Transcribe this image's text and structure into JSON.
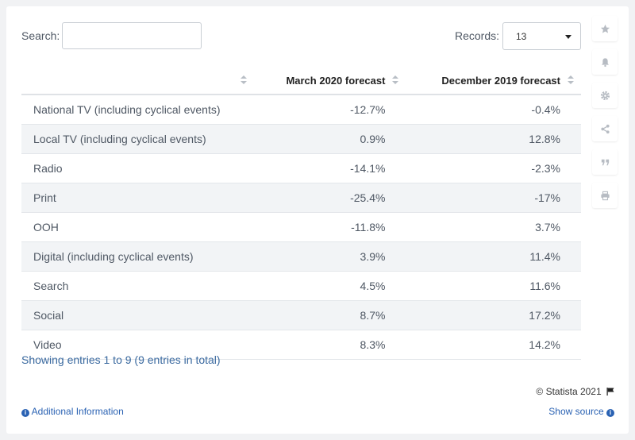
{
  "search": {
    "label": "Search:",
    "value": ""
  },
  "records": {
    "label": "Records:",
    "value": "13"
  },
  "table": {
    "headers": [
      "",
      "March 2020 forecast",
      "December 2019 forecast"
    ],
    "rows": [
      [
        "National TV (including cyclical events)",
        "-12.7%",
        "-0.4%"
      ],
      [
        "Local TV (including cyclical events)",
        "0.9%",
        "12.8%"
      ],
      [
        "Radio",
        "-14.1%",
        "-2.3%"
      ],
      [
        "Print",
        "-25.4%",
        "-17%"
      ],
      [
        "OOH",
        "-11.8%",
        "3.7%"
      ],
      [
        "Digital (including cyclical events)",
        "3.9%",
        "11.4%"
      ],
      [
        "Search",
        "4.5%",
        "11.6%"
      ],
      [
        "Social",
        "8.7%",
        "17.2%"
      ],
      [
        "Video",
        "8.3%",
        "14.2%"
      ]
    ]
  },
  "chart_data": {
    "type": "table",
    "columns": [
      "",
      "March 2020 forecast",
      "December 2019 forecast"
    ],
    "categories": [
      "National TV (including cyclical events)",
      "Local TV (including cyclical events)",
      "Radio",
      "Print",
      "OOH",
      "Digital (including cyclical events)",
      "Search",
      "Social",
      "Video"
    ],
    "series": [
      {
        "name": "March 2020 forecast",
        "values": [
          -12.7,
          0.9,
          -14.1,
          -25.4,
          -11.8,
          3.9,
          4.5,
          8.7,
          8.3
        ]
      },
      {
        "name": "December 2019 forecast",
        "values": [
          -0.4,
          12.8,
          -2.3,
          -17,
          3.7,
          11.4,
          11.6,
          17.2,
          14.2
        ]
      }
    ]
  },
  "footer": {
    "summary": "Showing entries 1 to 9 (9 entries in total)",
    "copyright": "© Statista 2021",
    "additional_info": "Additional Information",
    "show_source": "Show source"
  },
  "sidebar_icons": [
    "star-icon",
    "bell-icon",
    "gear-icon",
    "share-icon",
    "quote-icon",
    "print-icon"
  ],
  "colors": {
    "link": "#2a62b3",
    "summary": "#3b6aa0",
    "row_alt": "#f2f4f6",
    "background": "#f1f2f4"
  }
}
